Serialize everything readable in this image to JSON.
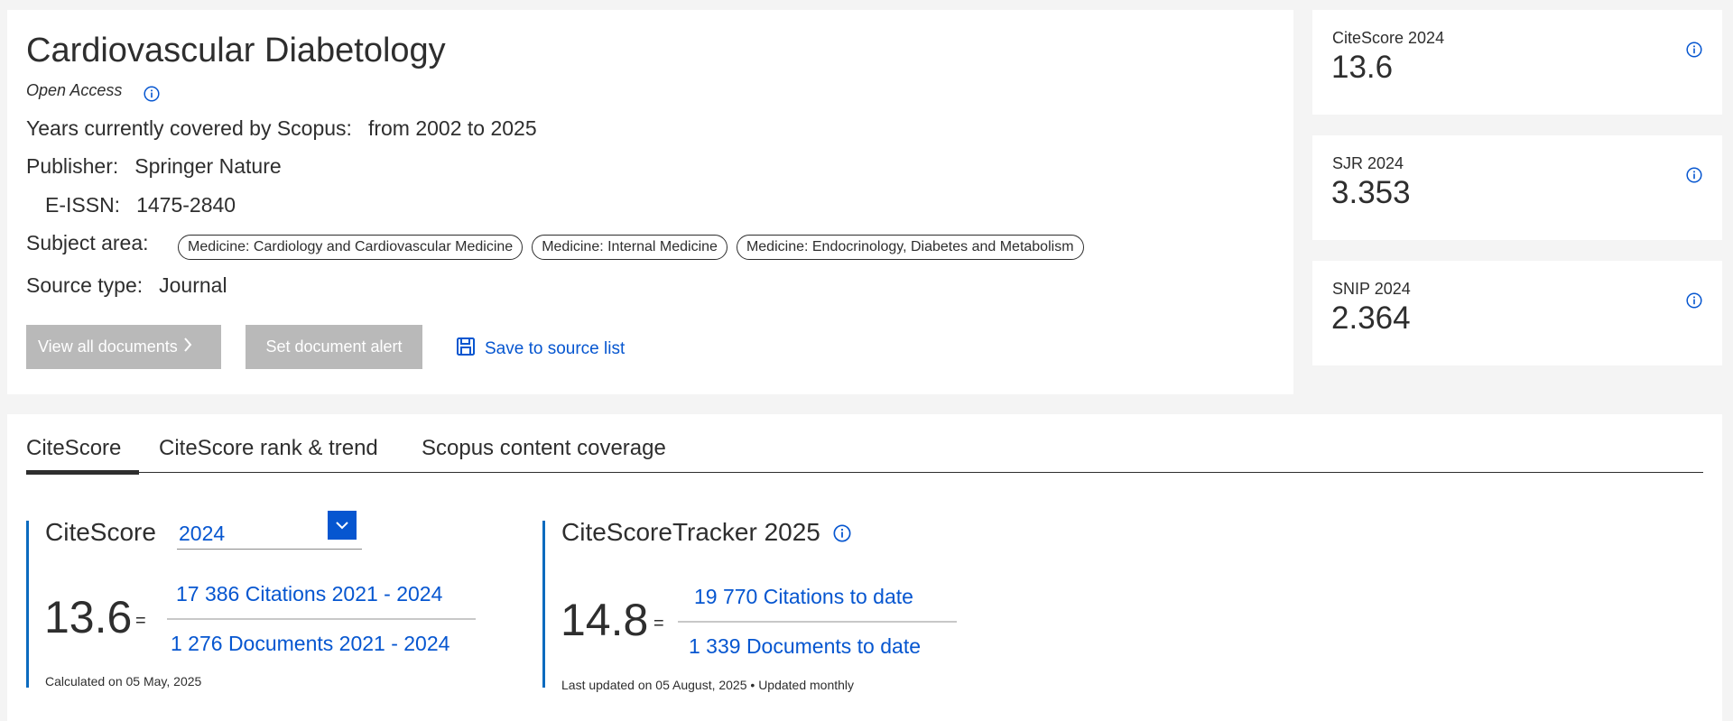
{
  "journal": {
    "title": "Cardiovascular Diabetology",
    "open_access": "Open Access",
    "years_label": "Years currently covered by Scopus:",
    "years_value": "from 2002 to 2025",
    "publisher_label": "Publisher:",
    "publisher_value": "Springer Nature",
    "eissn_label": "E-ISSN:",
    "eissn_value": "1475-2840",
    "subject_label": "Subject area:",
    "subjects": [
      "Medicine: Cardiology and Cardiovascular Medicine",
      "Medicine: Internal Medicine",
      "Medicine: Endocrinology, Diabetes and Metabolism"
    ],
    "source_type_label": "Source type:",
    "source_type_value": "Journal"
  },
  "actions": {
    "view_all": "View all documents",
    "set_alert": "Set document alert",
    "save_source": "Save to source list"
  },
  "metrics": [
    {
      "label": "CiteScore 2024",
      "value": "13.6"
    },
    {
      "label": "SJR 2024",
      "value": "3.353"
    },
    {
      "label": "SNIP 2024",
      "value": "2.364"
    }
  ],
  "tabs": [
    {
      "label": "CiteScore",
      "active": true
    },
    {
      "label": "CiteScore rank & trend",
      "active": false
    },
    {
      "label": "Scopus content coverage",
      "active": false
    }
  ],
  "citescore": {
    "heading": "CiteScore",
    "year": "2024",
    "value": "13.6",
    "equals": "=",
    "citations": "17 386 Citations 2021 - 2024",
    "documents": "1 276 Documents 2021 - 2024",
    "calculated": "Calculated on 05 May, 2025"
  },
  "tracker": {
    "heading": "CiteScoreTracker 2025",
    "value": "14.8",
    "equals": "=",
    "citations": "19 770 Citations to date",
    "documents": "1 339 Documents to date",
    "updated": "Last updated on 05 August, 2025 • Updated monthly"
  },
  "colors": {
    "accent_blue": "#0656d0",
    "bar_blue": "#0b6bbf",
    "disabled_button": "#b9b9b9",
    "page_background": "#f4f4f4"
  }
}
